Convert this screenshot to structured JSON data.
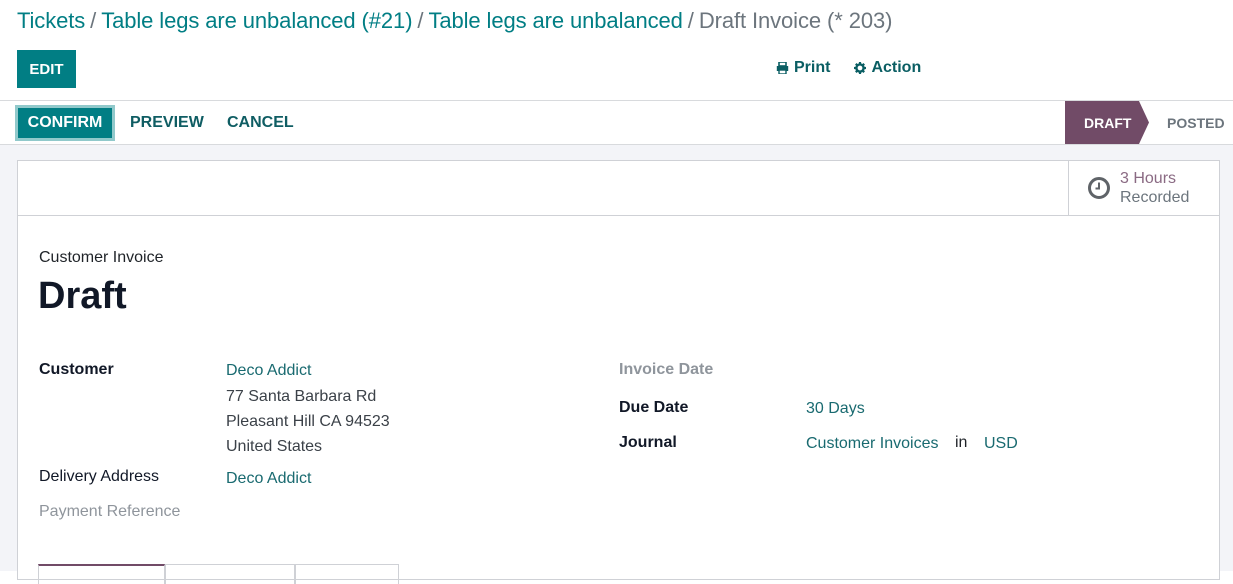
{
  "breadcrumb": {
    "items": [
      "Tickets",
      "Table legs are unbalanced (#21)",
      "Table legs are unbalanced"
    ],
    "current": "Draft Invoice (* 203)",
    "separator": "/"
  },
  "toolbar": {
    "edit_label": "EDIT",
    "print_label": "Print",
    "action_label": "Action",
    "print_icon": "printer-icon",
    "action_icon": "gear-icon"
  },
  "statusbar": {
    "confirm_label": "CONFIRM",
    "preview_label": "PREVIEW",
    "cancel_label": "CANCEL",
    "stages": [
      {
        "label": "DRAFT",
        "active": true
      },
      {
        "label": "POSTED",
        "active": false
      }
    ]
  },
  "stat_button": {
    "icon": "clock-icon",
    "value": "3 Hours",
    "label": "Recorded"
  },
  "form": {
    "doc_type": "Customer Invoice",
    "title": "Draft",
    "customer_label": "Customer",
    "customer_name": "Deco Addict",
    "customer_address": [
      "77 Santa Barbara Rd",
      "Pleasant Hill CA 94523",
      "United States"
    ],
    "delivery_label": "Delivery Address",
    "delivery_value": "Deco Addict",
    "payment_ref_label": "Payment Reference",
    "invoice_date_label": "Invoice Date",
    "due_date_label": "Due Date",
    "due_date_value": "30 Days",
    "journal_label": "Journal",
    "journal_value": "Customer Invoices",
    "journal_in": "in",
    "currency_value": "USD"
  },
  "colors": {
    "primary": "#017e84",
    "stage_active": "#714b67",
    "link": "#196a70"
  }
}
